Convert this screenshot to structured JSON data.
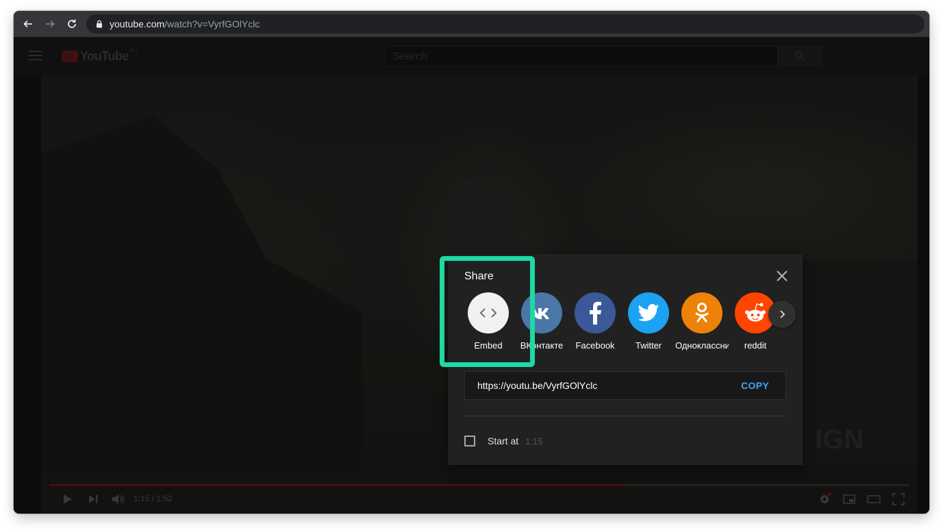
{
  "browser": {
    "url_host": "youtube.com",
    "url_path": "/watch?v=VyrfGOlYclc"
  },
  "youtube": {
    "logo_text": "YouTube",
    "region": "RU",
    "search_placeholder": "Search"
  },
  "player": {
    "time": "1:15 / 1:52",
    "progress_fraction": 0.67,
    "watermark": "IGN"
  },
  "share": {
    "title": "Share",
    "targets": [
      {
        "label": "Embed",
        "color": "#f1f1f1",
        "icon": "embed-icon"
      },
      {
        "label": "ВКонтакте",
        "color": "#4a76a8",
        "icon": "vk-icon"
      },
      {
        "label": "Facebook",
        "color": "#3b5998",
        "icon": "facebook-icon"
      },
      {
        "label": "Twitter",
        "color": "#1da1f2",
        "icon": "twitter-icon"
      },
      {
        "label": "Одноклассники",
        "color": "#ee8208",
        "icon": "odnoklassniki-icon"
      },
      {
        "label": "reddit",
        "color": "#ff4500",
        "icon": "reddit-icon"
      }
    ],
    "link": "https://youtu.be/VyrfGOlYclc",
    "copy_label": "COPY",
    "start_at_label": "Start at",
    "start_at_time": "1:15"
  },
  "colors": {
    "highlight": "#1ed9a2",
    "copy_accent": "#3ea6ff"
  }
}
